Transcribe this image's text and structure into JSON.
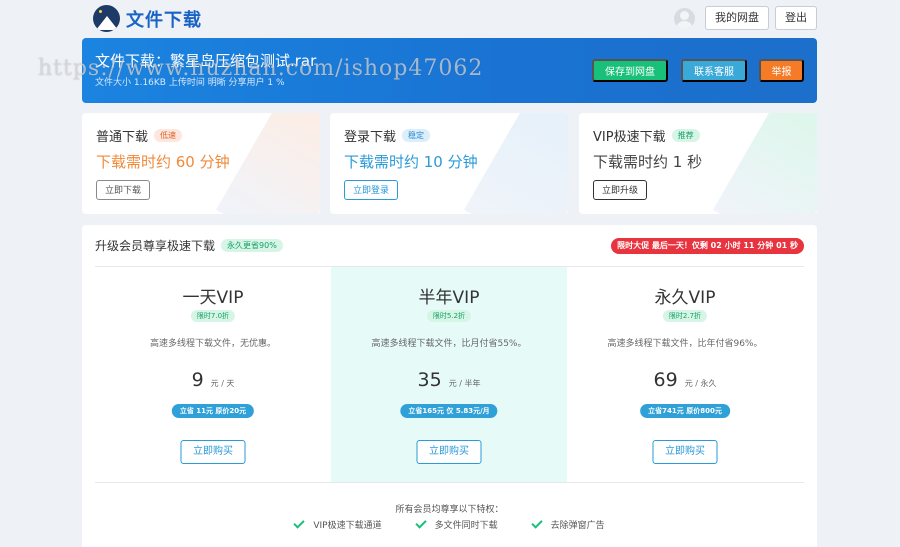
{
  "header": {
    "logo_text": "文件下载",
    "my_disk_label": "我的网盘",
    "logout_label": "登出"
  },
  "banner": {
    "title": "文件下载：繁星岛压缩包测试.rar",
    "meta": "文件大小 1.16KB  上传时间 明晰  分享用户 1 %",
    "save_label": "保存到网盘",
    "service_label": "联系客服",
    "report_label": "举报"
  },
  "watermark": "https://www.huzhan.com/ishop47062",
  "options": [
    {
      "name": "普通下载",
      "tag": "低速",
      "time": "下载需时约 60 分钟",
      "action": "立即下载"
    },
    {
      "name": "登录下载",
      "tag": "稳定",
      "time": "下载需时约 10 分钟",
      "action": "立即登录"
    },
    {
      "name": "VIP极速下载",
      "tag": "推荐",
      "time": "下载需时约 1 秒",
      "action": "立即升级"
    }
  ],
  "vip": {
    "title": "升级会员尊享极速下载",
    "title_tag": "永久更省90%",
    "promo": "限时大促 最后一天！仅剩 02 小时 11 分钟 01 秒",
    "plans": [
      {
        "name": "一天VIP",
        "discount": "限时7.0折",
        "desc": "高速多线程下载文件，无优惠。",
        "price": "9",
        "unit": "元 / 天",
        "save": "立省 11元 原价20元",
        "buy": "立即购买"
      },
      {
        "name": "半年VIP",
        "discount": "限时5.2折",
        "desc": "高速多线程下载文件，比月付省55%。",
        "price": "35",
        "unit": "元 / 半年",
        "save": "立省165元 仅 5.83元/月",
        "buy": "立即购买"
      },
      {
        "name": "永久VIP",
        "discount": "限时2.7折",
        "desc": "高速多线程下载文件，比年付省96%。",
        "price": "69",
        "unit": "元 / 永久",
        "save": "立省741元 原价800元",
        "buy": "立即购买"
      }
    ],
    "perks_title": "所有会员均尊享以下特权：",
    "perks": [
      "VIP极速下载通道",
      "多文件同时下载",
      "去除弹窗广告"
    ]
  }
}
